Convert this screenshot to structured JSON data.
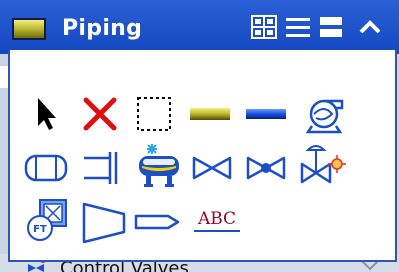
{
  "panel": {
    "title": "Piping",
    "buttons": [
      "icon-view",
      "list-view",
      "maximize",
      "collapse"
    ]
  },
  "tools": [
    {
      "name": "select-arrow-icon"
    },
    {
      "name": "delete-x-icon"
    },
    {
      "name": "selection-box-icon"
    },
    {
      "name": "yellow-pipe-icon"
    },
    {
      "name": "blue-pipe-icon"
    },
    {
      "name": "pump-icon"
    },
    {
      "name": "vessel-icon"
    },
    {
      "name": "flange-icon"
    },
    {
      "name": "heater-tank-icon"
    },
    {
      "name": "gate-valve-icon"
    },
    {
      "name": "globe-valve-icon"
    },
    {
      "name": "control-valve-icon"
    },
    {
      "name": "flow-transmitter-icon"
    },
    {
      "name": "reducer-icon"
    },
    {
      "name": "pipe-end-icon"
    },
    {
      "name": "text-label-icon",
      "text": "ABC"
    }
  ],
  "below": {
    "label": "Control Valves"
  }
}
